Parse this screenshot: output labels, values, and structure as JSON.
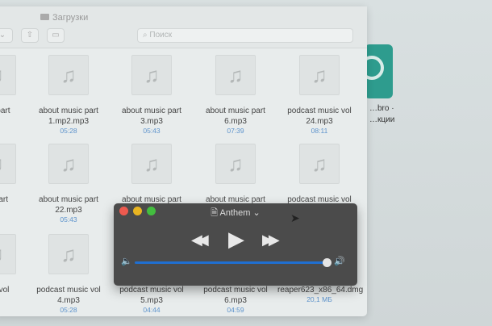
{
  "desktop": {
    "app_label": [
      "…bro ·",
      "…кции"
    ],
    "accent": "#2e9c8e"
  },
  "finder": {
    "title": "Загрузки",
    "search_placeholder": "Поиск",
    "items": [
      {
        "name": "…c part",
        "duration": ""
      },
      {
        "name": "about music part 1.mp2.mp3",
        "duration": "05:28"
      },
      {
        "name": "about music part 3.mp3",
        "duration": "05:43"
      },
      {
        "name": "about music part 6.mp3",
        "duration": "07:39"
      },
      {
        "name": "podcast music vol 24.mp3",
        "duration": "08:11"
      },
      {
        "name": "… part",
        "duration": ""
      },
      {
        "name": "about music part 22.mp3",
        "duration": "05:43"
      },
      {
        "name": "about music part",
        "duration": ""
      },
      {
        "name": "about music part",
        "duration": ""
      },
      {
        "name": "podcast music vol",
        "duration": ""
      },
      {
        "name": "…ic vol",
        "duration": ""
      },
      {
        "name": "podcast music vol 4.mp3",
        "duration": "05:28"
      },
      {
        "name": "podcast music vol 5.mp3",
        "duration": "04:44"
      },
      {
        "name": "podcast music vol 6.mp3",
        "duration": "04:59"
      },
      {
        "name": "reaper623_x86_64.dmg",
        "duration": "20,1 МБ"
      }
    ]
  },
  "player": {
    "title": "Anthem",
    "volume": 0.99,
    "colors": {
      "close": "#ed5a4f",
      "minimize": "#e9b521",
      "zoom": "#43be3f",
      "slider": "#1f6fd1"
    }
  }
}
